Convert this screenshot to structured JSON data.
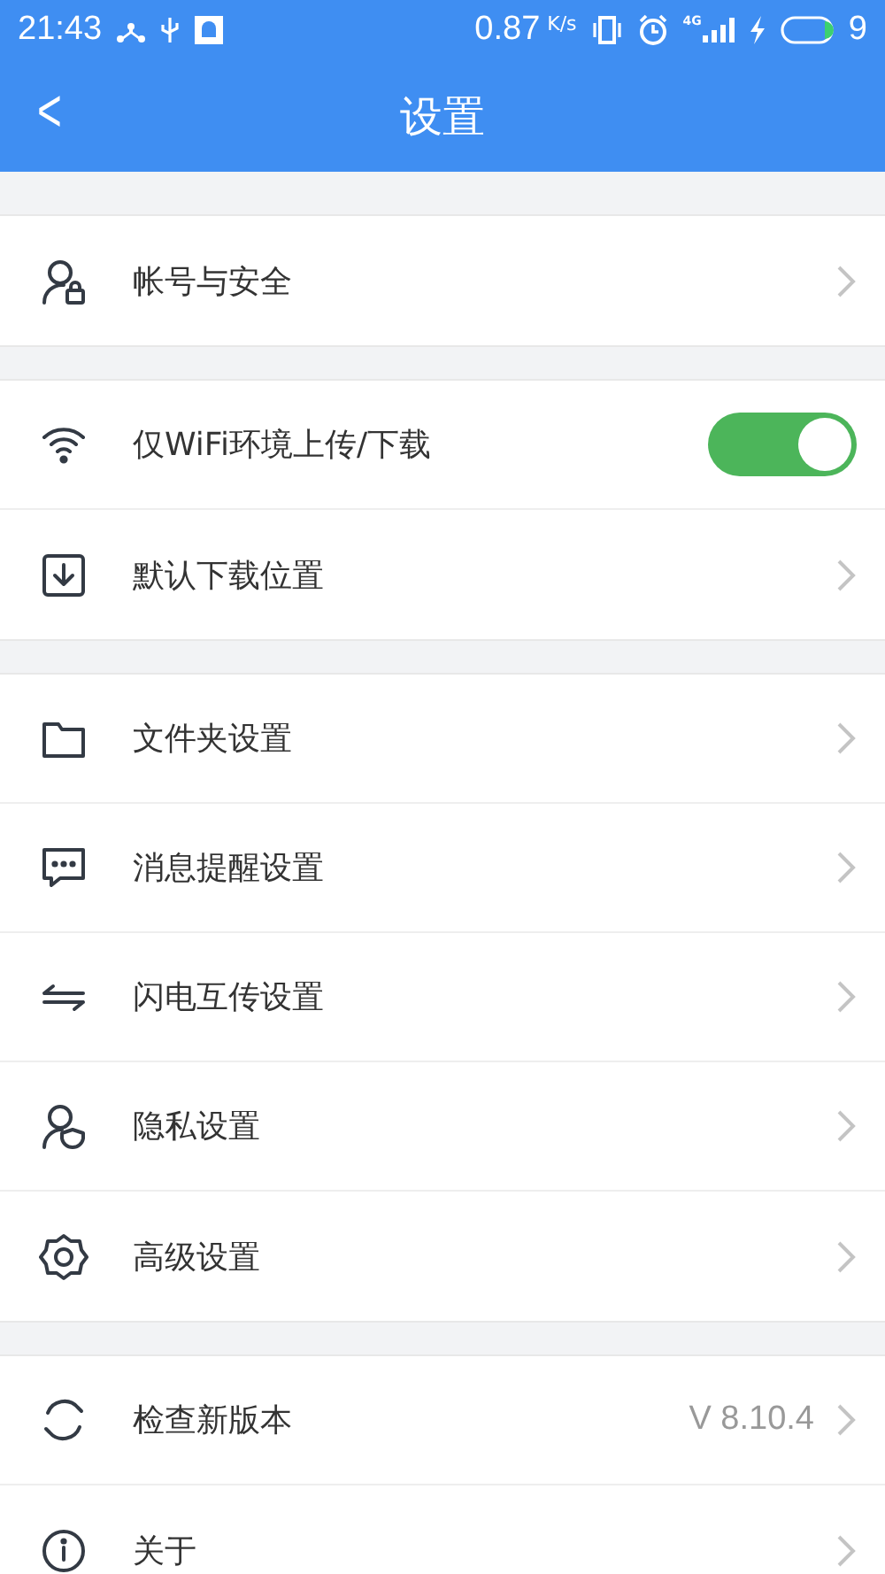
{
  "status_bar": {
    "time": "21:43",
    "speed": "0.87",
    "speed_unit": "K/s",
    "network": "4G",
    "battery": "9"
  },
  "header": {
    "back": "<",
    "title": "设置"
  },
  "groups": [
    {
      "items": [
        {
          "kind": "link",
          "label": "帐号与安全"
        }
      ]
    },
    {
      "items": [
        {
          "kind": "toggle",
          "label": "仅WiFi环境上传/下载",
          "on": true
        },
        {
          "kind": "link",
          "label": "默认下载位置"
        }
      ]
    },
    {
      "items": [
        {
          "kind": "link",
          "label": "文件夹设置"
        },
        {
          "kind": "link",
          "label": "消息提醒设置"
        },
        {
          "kind": "link",
          "label": "闪电互传设置"
        },
        {
          "kind": "link",
          "label": "隐私设置"
        },
        {
          "kind": "link",
          "label": "高级设置"
        }
      ]
    },
    {
      "items": [
        {
          "kind": "link",
          "label": "检查新版本",
          "value": "V 8.10.4"
        },
        {
          "kind": "link",
          "label": "关于"
        }
      ]
    }
  ]
}
